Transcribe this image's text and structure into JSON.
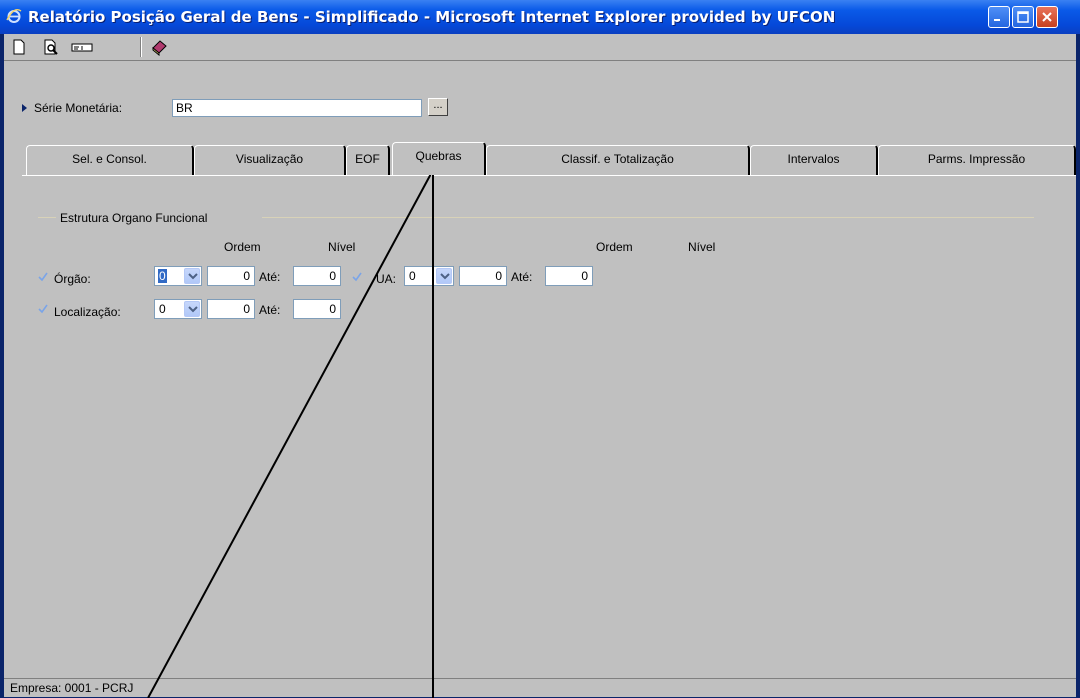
{
  "window": {
    "title": "Relatório Posição Geral de Bens - Simplificado - Microsoft Internet Explorer provided by UFCON"
  },
  "toolbar": {
    "icons": [
      "new-document-icon",
      "print-preview-icon",
      "field-icon",
      "book-icon"
    ]
  },
  "serie": {
    "label": "Série Monetária:",
    "value": "BR",
    "browse_label": "..."
  },
  "tabs": [
    {
      "label": "Sel. e Consol."
    },
    {
      "label": "Visualização"
    },
    {
      "label": "EOF"
    },
    {
      "label": "Quebras",
      "active": true
    },
    {
      "label": "Classif. e Totalização"
    },
    {
      "label": "Intervalos"
    },
    {
      "label": "Parms. Impressão"
    }
  ],
  "group": {
    "title": "Estrutura Organo Funcional",
    "header_ordem": "Ordem",
    "header_nivel": "Nível",
    "ate_label": "Até:",
    "rows": {
      "orgao": {
        "label": "Órgão:",
        "ordem": "0",
        "nivel": "0",
        "ate": "0"
      },
      "ua": {
        "label": "UA:",
        "ordem": "0",
        "nivel": "0",
        "ate": "0"
      },
      "localizacao": {
        "label": "Localização:",
        "ordem": "0",
        "nivel": "0",
        "ate": "0"
      }
    }
  },
  "status": {
    "text": "Empresa: 0001 - PCRJ"
  },
  "colors": {
    "titlebar": "#0548d8",
    "panel": "#c0c0c0",
    "check": "#7aa4e8"
  }
}
